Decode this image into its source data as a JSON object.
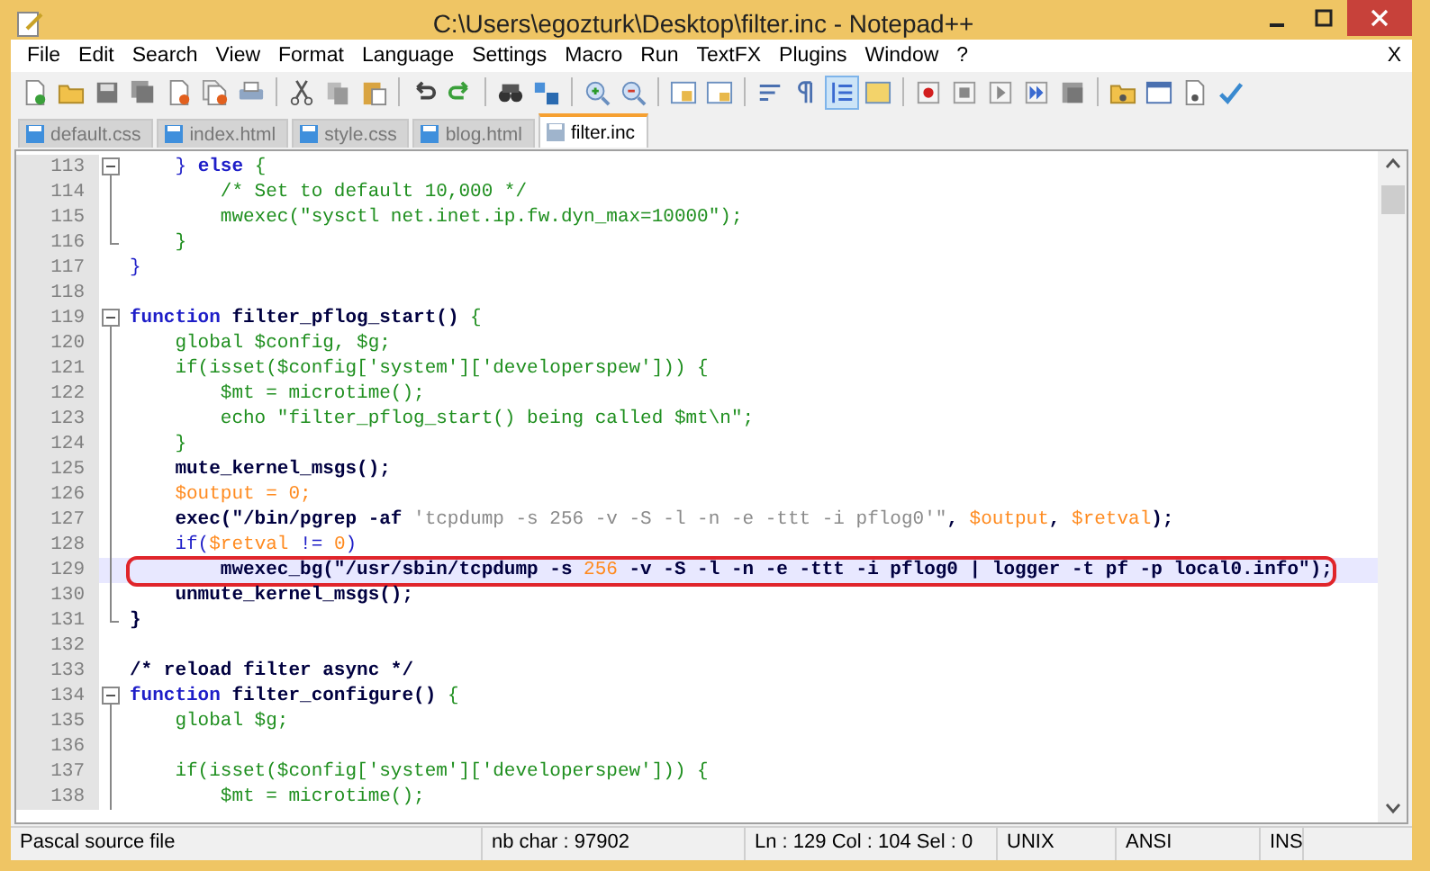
{
  "window": {
    "title": "C:\\Users\\egozturk\\Desktop\\filter.inc - Notepad++"
  },
  "menu": [
    {
      "label": "File"
    },
    {
      "label": "Edit"
    },
    {
      "label": "Search"
    },
    {
      "label": "View"
    },
    {
      "label": "Format"
    },
    {
      "label": "Language"
    },
    {
      "label": "Settings"
    },
    {
      "label": "Macro"
    },
    {
      "label": "Run"
    },
    {
      "label": "TextFX"
    },
    {
      "label": "Plugins"
    },
    {
      "label": "Window"
    },
    {
      "label": "?"
    }
  ],
  "menu_close": "X",
  "toolbar": [
    {
      "kind": "new",
      "selected": false
    },
    {
      "kind": "open",
      "selected": false
    },
    {
      "kind": "save",
      "selected": false
    },
    {
      "kind": "saveall",
      "selected": false
    },
    {
      "kind": "close",
      "selected": false
    },
    {
      "kind": "closeall",
      "selected": false
    },
    {
      "kind": "print",
      "selected": false
    },
    {
      "kind": "sep"
    },
    {
      "kind": "cut",
      "selected": false
    },
    {
      "kind": "copy",
      "selected": false
    },
    {
      "kind": "paste",
      "selected": false
    },
    {
      "kind": "sep"
    },
    {
      "kind": "undo",
      "selected": false
    },
    {
      "kind": "redo",
      "selected": false
    },
    {
      "kind": "sep"
    },
    {
      "kind": "find",
      "selected": false
    },
    {
      "kind": "replace",
      "selected": false
    },
    {
      "kind": "sep"
    },
    {
      "kind": "zoomin",
      "selected": false
    },
    {
      "kind": "zoomout",
      "selected": false
    },
    {
      "kind": "sep"
    },
    {
      "kind": "syncv",
      "selected": false
    },
    {
      "kind": "synch",
      "selected": false
    },
    {
      "kind": "sep"
    },
    {
      "kind": "wrap",
      "selected": false
    },
    {
      "kind": "allchars",
      "selected": false
    },
    {
      "kind": "indent",
      "selected": true
    },
    {
      "kind": "lang",
      "selected": false
    },
    {
      "kind": "sep"
    },
    {
      "kind": "record",
      "selected": false
    },
    {
      "kind": "stop",
      "selected": false
    },
    {
      "kind": "play",
      "selected": false
    },
    {
      "kind": "playmulti",
      "selected": false
    },
    {
      "kind": "savemacro",
      "selected": false
    },
    {
      "kind": "sep"
    },
    {
      "kind": "folder",
      "selected": false
    },
    {
      "kind": "window",
      "selected": false
    },
    {
      "kind": "doc",
      "selected": false
    },
    {
      "kind": "spell",
      "selected": false
    }
  ],
  "tabs": [
    {
      "label": "default.css",
      "selected": false
    },
    {
      "label": "index.html",
      "selected": false
    },
    {
      "label": "style.css",
      "selected": false
    },
    {
      "label": "blog.html",
      "selected": false
    },
    {
      "label": "filter.inc",
      "selected": true
    }
  ],
  "lines": [
    {
      "number": "113",
      "kind": "open",
      "current": false,
      "tokens": [
        {
          "t": "    } ",
          "kind": "kw"
        },
        {
          "t": "else",
          "kind": "kwb"
        },
        {
          "t": " {",
          "kind": "green"
        }
      ]
    },
    {
      "number": "114",
      "kind": "mid",
      "current": false,
      "tokens": [
        {
          "t": "        /* Set to default 10,000 */",
          "kind": "green"
        }
      ]
    },
    {
      "number": "115",
      "kind": "mid",
      "current": false,
      "tokens": [
        {
          "t": "        mwexec(\"sysctl net.inet.ip.fw.dyn_max=10000\");",
          "kind": "green"
        }
      ]
    },
    {
      "number": "116",
      "kind": "end",
      "current": false,
      "tokens": [
        {
          "t": "    }",
          "kind": "green"
        }
      ]
    },
    {
      "number": "117",
      "kind": "plain",
      "current": false,
      "tokens": [
        {
          "t": "}",
          "kind": "kw"
        }
      ]
    },
    {
      "number": "118",
      "kind": "plain",
      "current": false
    },
    {
      "number": "119",
      "kind": "open",
      "current": false,
      "tokens": [
        {
          "t": "function",
          "kind": "kwb"
        },
        {
          "t": " filter_pflog_start()",
          "kind": "dark"
        },
        {
          "t": " {",
          "kind": "green"
        }
      ]
    },
    {
      "number": "120",
      "kind": "mid",
      "current": false,
      "tokens": [
        {
          "t": "    global $config, $g;",
          "kind": "green"
        }
      ]
    },
    {
      "number": "121",
      "kind": "mid",
      "current": false,
      "tokens": [
        {
          "t": "    if(isset($config['system']['developerspew'])) {",
          "kind": "green"
        }
      ]
    },
    {
      "number": "122",
      "kind": "mid",
      "current": false,
      "tokens": [
        {
          "t": "        $mt = microtime();",
          "kind": "green"
        }
      ]
    },
    {
      "number": "123",
      "kind": "mid",
      "current": false,
      "tokens": [
        {
          "t": "        echo \"filter_pflog_start() being called $mt\\n\";",
          "kind": "green"
        }
      ]
    },
    {
      "number": "124",
      "kind": "mid",
      "current": false,
      "tokens": [
        {
          "t": "    }",
          "kind": "green"
        }
      ]
    },
    {
      "number": "125",
      "kind": "mid",
      "current": false,
      "tokens": [
        {
          "t": "    mute_kernel_msgs();",
          "kind": "dark"
        }
      ]
    },
    {
      "number": "126",
      "kind": "mid",
      "current": false,
      "tokens": [
        {
          "t": "    $output = 0;",
          "kind": "orange"
        }
      ]
    },
    {
      "number": "127",
      "kind": "mid",
      "current": false,
      "tokens": [
        {
          "t": "    exec(\"/bin/pgrep -af ",
          "kind": "dark"
        },
        {
          "t": "'tcpdump -s 256 -v -S -l -n -e -ttt -i pflog0'\"",
          "kind": "gray"
        },
        {
          "t": ", ",
          "kind": "dark"
        },
        {
          "t": "$output",
          "kind": "orange"
        },
        {
          "t": ", ",
          "kind": "dark"
        },
        {
          "t": "$retval",
          "kind": "orange"
        },
        {
          "t": ");",
          "kind": "dark"
        }
      ]
    },
    {
      "number": "128",
      "kind": "mid",
      "current": false,
      "tokens": [
        {
          "t": "    if(",
          "kind": "kw"
        },
        {
          "t": "$retval",
          "kind": "orange"
        },
        {
          "t": " != ",
          "kind": "kw"
        },
        {
          "t": "0",
          "kind": "orange"
        },
        {
          "t": ")",
          "kind": "kw"
        }
      ]
    },
    {
      "number": "129",
      "kind": "mid",
      "current": true,
      "annotated": true,
      "tokens": [
        {
          "t": "        mwexec_bg(\"/usr/sbin/tcpdump -s ",
          "kind": "dark"
        },
        {
          "t": "256",
          "kind": "orange"
        },
        {
          "t": " -v -S -l -n -e -ttt -i pflog0 | logger -t pf -p local0.info\");",
          "kind": "dark"
        }
      ]
    },
    {
      "number": "130",
      "kind": "mid",
      "current": false,
      "tokens": [
        {
          "t": "    unmute_kernel_msgs();",
          "kind": "dark"
        }
      ]
    },
    {
      "number": "131",
      "kind": "end",
      "current": false,
      "tokens": [
        {
          "t": "}",
          "kind": "dark"
        }
      ]
    },
    {
      "number": "132",
      "kind": "plain",
      "current": false
    },
    {
      "number": "133",
      "kind": "plain",
      "current": false,
      "tokens": [
        {
          "t": "/* reload filter async */",
          "kind": "dark"
        }
      ]
    },
    {
      "number": "134",
      "kind": "open",
      "current": false,
      "tokens": [
        {
          "t": "function",
          "kind": "kwb"
        },
        {
          "t": " filter_configure()",
          "kind": "dark"
        },
        {
          "t": " {",
          "kind": "green"
        }
      ]
    },
    {
      "number": "135",
      "kind": "mid",
      "current": false,
      "tokens": [
        {
          "t": "    global $g;",
          "kind": "green"
        }
      ]
    },
    {
      "number": "136",
      "kind": "mid",
      "current": false
    },
    {
      "number": "137",
      "kind": "mid",
      "current": false,
      "tokens": [
        {
          "t": "    if(isset($config['system']['developerspew'])) {",
          "kind": "green"
        }
      ]
    },
    {
      "number": "138",
      "kind": "mid",
      "current": false,
      "tokens": [
        {
          "t": "        $mt = microtime();",
          "kind": "green"
        }
      ]
    }
  ],
  "status_bar": [
    {
      "text": "Pascal source file"
    },
    {
      "text": "nb char : 97902"
    },
    {
      "text": "Ln : 129    Col : 104    Sel : 0"
    },
    {
      "text": "UNIX"
    },
    {
      "text": "ANSI"
    },
    {
      "text": "INS"
    }
  ]
}
